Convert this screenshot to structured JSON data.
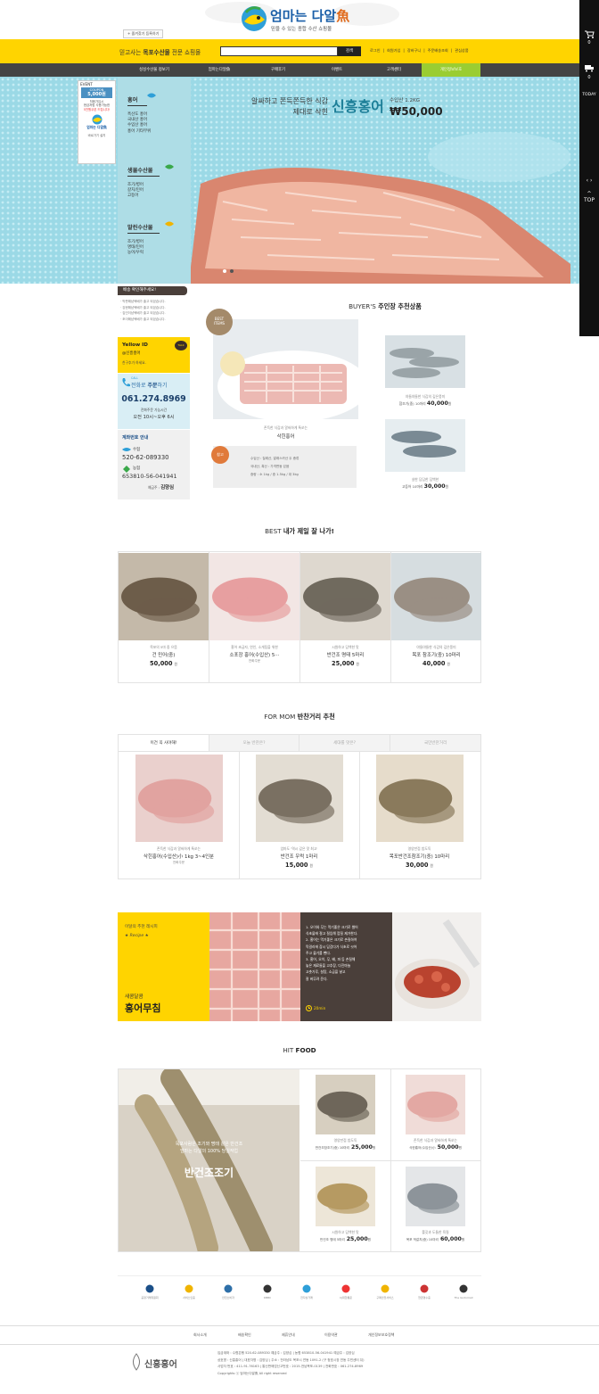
{
  "header": {
    "favorite_label": "+ 즐겨찾기 등록하기",
    "brand_main": "엄마는 다알",
    "brand_fish": "魚",
    "brand_sub": "믿을 수 있는 종합 수산 쇼핑몰",
    "tagline_pre": "믿고사는 ",
    "tagline_bold": "목포수산물",
    "tagline_post": " 전문 쇼핑몰",
    "search_placeholder": "",
    "search_button": "검색",
    "links": [
      "로그인",
      "회원가입",
      "장바구니",
      "주문배송조회",
      "관심상품"
    ]
  },
  "nav": [
    "싱싱수산물 정보기",
    "엄마는다알魚",
    "구매후기",
    "이벤트",
    "고객센터",
    "개인정보보호"
  ],
  "right_bar": {
    "today": "TODAY",
    "top": "TOP",
    "cart_count": "0",
    "delivery_count": "0"
  },
  "event_banner": {
    "label": "EVENT",
    "coupon_label": "COUPON",
    "coupon_amount": "5,000원",
    "text1": "처음가입시",
    "text2": "현금처럼 사용가능한",
    "text3": "5천원쿠폰 드립니다!",
    "logo": "엄마는 다알魚",
    "caption": "바로가기 설치"
  },
  "categories": [
    {
      "title": "홍어",
      "items": [
        "흑산도 홍어",
        "국내산 홍어",
        "수입산 홍어",
        "홍어 기타부위"
      ]
    },
    {
      "title": "생물수산물",
      "items": [
        "조기/병어",
        "갈치/민어",
        "고등어"
      ]
    },
    {
      "title": "말린수산물",
      "items": [
        "조기/병어",
        "명태/민어",
        "농어/우럭"
      ]
    }
  ],
  "hero": {
    "line1": "알싸하고 쫀득쫀득한 식감",
    "line2": "제대로 삭힌",
    "name": "신흥홍어",
    "origin": "수입산 1.2KG",
    "price": "₩50,000"
  },
  "notice": {
    "title": "배송 확인해주세요!",
    "items": [
      "· 막판해남택배가 출고 되었습니다.",
      "· 강현해남택배가 출고 되었습니다.",
      "· 김인이남택배가 출고 되었습니다.",
      "· 조이해남택배가 출고 되었습니다."
    ]
  },
  "yellow_id": {
    "title": "Yellow ID",
    "id": "@신흥홍어",
    "sub": "친구추가 하세요.",
    "badge": "TALK"
  },
  "call": {
    "label_pre": "전화로 ",
    "label_bold": "주문",
    "label_post": "하기",
    "small": "CALL",
    "number": "061.274.8969",
    "line1": "전화주문 가능시간",
    "line2": "오전 10시~오후 6시"
  },
  "account": {
    "title": "계좌번호 안내",
    "bank1": "수협",
    "num1": "520-62-089330",
    "bank2": "농협",
    "num2": "653810-56-041941",
    "holder_label": "예금주 :",
    "holder": "김양심"
  },
  "buyers": {
    "title_pre": "BUYER'S ",
    "title_bold": "주인장 추천상품",
    "badge1": "BEST",
    "badge2": "ITEMS",
    "main_desc": "존득한 식감과 알싸하게 톡쏘는",
    "main_name": "삭힌홍어",
    "info_tag": "참고",
    "info": [
      "수입산 : 칠레산, 알래스카산 두 종류",
      "국내산, 흑산 : 가격변동 있음",
      "중량 : 소 1kg / 중 1.5kg / 대 3kg"
    ],
    "side": [
      {
        "desc": "야들야들한 식감의 깊은풍미",
        "name": "참조기(중) 10마리",
        "price": "40,000",
        "won": "원"
      },
      {
        "desc": "살한 담담한 담백한",
        "name": "고등어 10마리",
        "price": "30,000",
        "won": "원"
      }
    ]
  },
  "best": {
    "title_pre": "BEST ",
    "title_bold": "내가 제일 잘 나가!",
    "items": [
      {
        "desc": "목포의 5마 중 으뜸",
        "name": "건 민어(중)",
        "price": "50,000",
        "won": "원",
        "sub": ""
      },
      {
        "desc": "홍어 초급자, 연인, 소개팅을 위한",
        "name": "소포장 홍어(수입산) 5···",
        "price": "",
        "won": "",
        "sub": "전화주문"
      },
      {
        "desc": "시원하고 담백한 맛",
        "name": "반건조 명태 5마리",
        "price": "25,000",
        "won": "원",
        "sub": ""
      },
      {
        "desc": "야들야들한 식감의 깊은풍미",
        "name": "목포 참조기(중) 10마리",
        "price": "40,000",
        "won": "원",
        "sub": ""
      }
    ]
  },
  "formom": {
    "title_pre": "FOR MOM ",
    "title_bold": "반찬거리 추천",
    "tabs": [
      "이건 꼭 사야해!",
      "오늘 반찬은?",
      "세대를 맛은?",
      "국민반찬거리"
    ],
    "items": [
      {
        "desc": "존득한 식감과 알싸하게 톡쏘는",
        "name": "삭힌홍어(수입산)小 1kg 3~4인분",
        "price": "",
        "won": "",
        "sub": "전화주문"
      },
      {
        "desc": "엄마도 '역시 깊은 맛 최고'",
        "name": "반건조 우럭 1마리",
        "price": "15,000",
        "won": "원",
        "sub": ""
      },
      {
        "desc": "영양만점 밥도둑",
        "name": "목포반건조참조기(중) 10마리",
        "price": "30,000",
        "won": "원",
        "sub": ""
      }
    ]
  },
  "recipe": {
    "label": "이달의 추천 레시피",
    "tag": "★ Recipe ★",
    "sub": "새콤달콤",
    "title": "홍어무침",
    "time": "20min",
    "steps": [
      "1. 오이와 무는 먹기좋은 크기로 썰어",
      "식초물에 절고 절임해 껍질 제거한다.",
      "2. 홍어는 먹기좋은 크기로 손질하여",
      "막걸리에 잠시 담갔다가 식초로 씻어",
      "주고 물기를 뺀다.",
      "3. 홍어, 오이, 무, 배, 파 등 손질해",
      "놓은 재료들을 고추장, 다진마늘",
      "고춧가루, 설탕, 소금을 넣고",
      "잘 버무려 준다."
    ]
  },
  "hitfood": {
    "title_pre": "HIT ",
    "title_bold": "FOOD",
    "big_line1": "목포사람은 조기와 명태 같은 반건조",
    "big_line2": "엄마는 다알의 100% 당일작업",
    "big_title": "반건조조기",
    "items": [
      {
        "desc": "영양만점 밥도둑",
        "name": "반건조참조기(중) 10마리",
        "price": "25,000",
        "won": "원"
      },
      {
        "desc": "존득한 식감과 알싸하게 톡쏘는",
        "name": "삭힌홍어(수입산)小",
        "price": "50,000",
        "won": "원"
      },
      {
        "desc": "시원하고 담백한 맛",
        "name": "반건조 명태 5마리",
        "price": "25,000",
        "won": "원"
      },
      {
        "desc": "쫄깃과 도톰한 육질",
        "name": "목포 먹갈치(중) 10마리",
        "price": "60,000",
        "won": "원"
      }
    ]
  },
  "partners": [
    {
      "icon": "eye",
      "label": "공정거래위원회"
    },
    {
      "icon": "smile",
      "label": "서비스인증"
    },
    {
      "icon": "link",
      "label": "안전소비자"
    },
    {
      "icon": "kbbc",
      "label": "KBBC"
    },
    {
      "icon": "globe",
      "label": "전자상거래"
    },
    {
      "icon": "cj",
      "label": "CJ대한통운"
    },
    {
      "icon": "smile2",
      "label": "구매안전서비스"
    },
    {
      "icon": "box",
      "label": "현금영수증"
    },
    {
      "icon": "godo",
      "label": "The Godomall"
    }
  ],
  "footer": {
    "links": [
      "회사소개",
      "배송확인",
      "제휴안내",
      "이용약관",
      "개인정보보호정책"
    ],
    "logo": "신흥홍어",
    "lines": [
      "입금계좌 : 수협은행 520-62-089330 예금주 : 김양심   |   농협 653810-56-041941 예금주 : 김양심",
      "상호명 : 신흥홍어  |  대표자명 : 김양심  |  주소 : 전라남도 목포시 연동 1091-2 (구 청호시장 연동 주민센터 뒤)",
      "사업자 번호 : 411-91-76163  |  통신판매업신고번호 : 2015-전남목포-0139  |  전화번호 : 061-274-8969",
      "Copyrights ⓒ 엄마는다알魚 All right reserved"
    ]
  },
  "colors": {
    "yellow": "#ffd400",
    "dark": "#444444",
    "brown": "#4a3f3a",
    "gray_nav": "#444444",
    "accent_green": "#9acd32"
  }
}
